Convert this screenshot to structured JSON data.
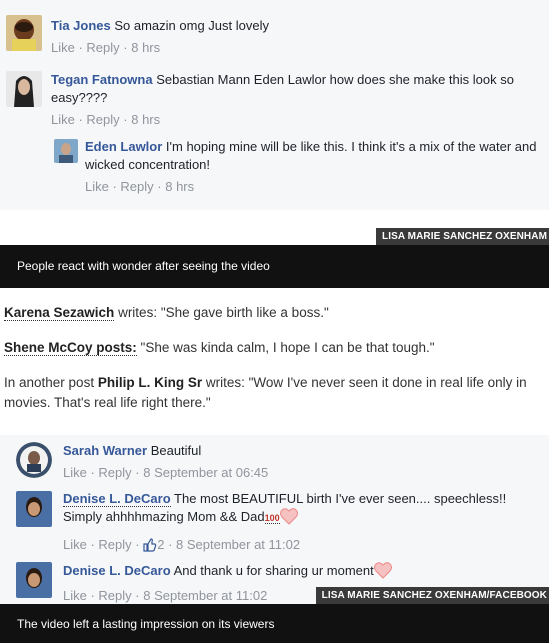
{
  "top_comments": [
    {
      "name": "Tia Jones",
      "text": "So amazin omg Just lovely",
      "like": "Like",
      "reply": "Reply",
      "time": "8 hrs"
    },
    {
      "name": "Tegan Fatnowna",
      "text": "Sebastian Mann Eden Lawlor how does she make this look so easy????",
      "like": "Like",
      "reply": "Reply",
      "time": "8 hrs"
    },
    {
      "name": "Eden Lawlor",
      "text": "I'm hoping mine will be like this. I think it's a mix of the water and wicked concentration!",
      "like": "Like",
      "reply": "Reply",
      "time": "8 hrs"
    }
  ],
  "credit1": "LISA MARIE SANCHEZ OXENHAM",
  "caption1": "People react with wonder after seeing the video",
  "paragraphs": [
    {
      "name": "Karena Sezawich",
      "text": " writes: \"She gave birth like a boss.\""
    },
    {
      "name": "Shene McCoy posts:",
      "text": " \"She was kinda calm, I hope I can be that tough.\""
    },
    {
      "prefix": "In another post ",
      "name": "Philip L. King Sr",
      "text": " writes: \"Wow I've never seen it done in real life only in movies. That's real life right there.\""
    }
  ],
  "bottom_comments": [
    {
      "name": "Sarah Warner",
      "text": "Beautiful",
      "like": "Like",
      "reply": "Reply",
      "time": "8 September at 06:45"
    },
    {
      "name": "Denise L. DeCaro",
      "text": "The most BEAUTIFUL birth I've ever seen.... speechless!! Simply ahhhhmazing Mom && Dad",
      "emoji_text": "100",
      "like": "Like",
      "reply": "Reply",
      "likes_count": "2",
      "time": "8 September at 11:02"
    },
    {
      "name": "Denise L. DeCaro",
      "text": "And thank u for sharing ur moment",
      "like": "Like",
      "reply": "Reply",
      "time": "8 September at 11:02"
    }
  ],
  "credit2": "LISA MARIE SANCHEZ OXENHAM/FACEBOOK",
  "caption2": "The video left a lasting impression on its viewers",
  "colors": {
    "name_blue": "#365899",
    "meta_gray": "#90949c",
    "fb_bg": "#f6f7f9",
    "caption_bg": "#111111",
    "heart": "#f28c8c"
  }
}
